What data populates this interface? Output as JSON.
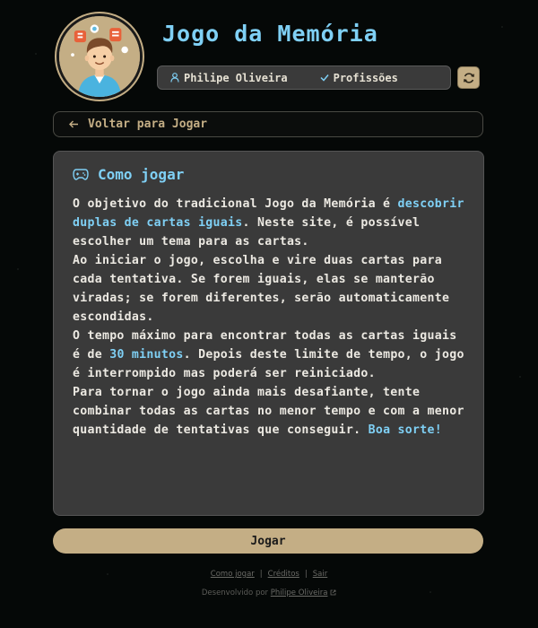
{
  "header": {
    "title": "Jogo da Memória",
    "user_name": "Philipe Oliveira",
    "theme": "Profissões",
    "icons": {
      "user": "user-icon",
      "check": "check-icon",
      "refresh": "refresh-icon"
    }
  },
  "nav": {
    "back_label": "Voltar para Jogar"
  },
  "card": {
    "title": "Como jogar",
    "p1_a": "O objetivo do tradicional Jogo da Memória é ",
    "p1_hl": "descobrir duplas de cartas iguais",
    "p1_b": ". Neste site, é possível escolher um tema para as cartas.",
    "p2": "Ao iniciar o jogo, escolha e vire duas cartas para cada tentativa. Se forem iguais, elas se manterão viradas; se forem diferentes, serão automaticamente escondidas.",
    "p3_a": "O tempo máximo para encontrar todas as cartas iguais é de ",
    "p3_hl": "30 minutos",
    "p3_b": ". Depois deste limite de tempo, o jogo é interrompido mas poderá ser reiniciado.",
    "p4_a": "Para tornar o jogo ainda mais desafiante, tente combinar todas as cartas no menor tempo e com a menor quantidade de tentativas que conseguir. ",
    "p4_hl": "Boa sorte!"
  },
  "play_label": "Jogar",
  "footer": {
    "links": [
      "Como jogar",
      "Créditos",
      "Sair"
    ],
    "dev_prefix": "Desenvolvido por ",
    "dev_name": "Philipe Oliveira"
  },
  "colors": {
    "accent": "#7fd0f5",
    "gold": "#c4ae85",
    "card": "#3a3a3a",
    "bg": "#050807"
  }
}
